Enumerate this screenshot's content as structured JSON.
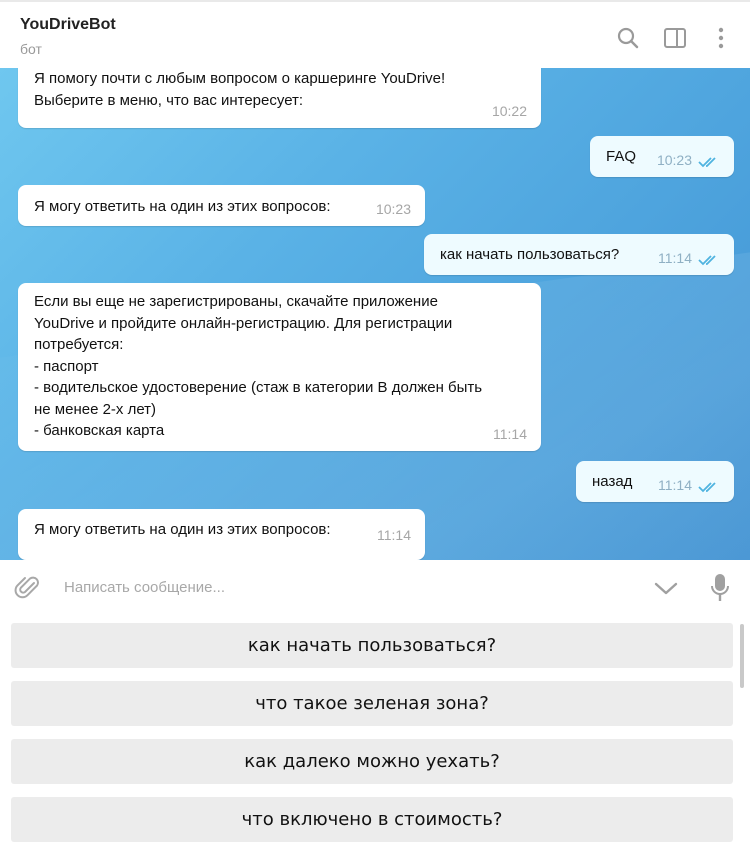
{
  "header": {
    "title": "YouDriveBot",
    "subtitle": "бот",
    "icons": [
      "search-icon",
      "sidebar-toggle-icon",
      "more-vertical-icon"
    ]
  },
  "messages": [
    {
      "direction": "in",
      "lines": [
        "Я помогу почти с любым вопросом о каршеринге YouDrive!",
        "Выберите в меню, что вас интересует:"
      ],
      "time": "10:22"
    },
    {
      "direction": "out",
      "text": "FAQ",
      "time": "10:23",
      "status": "read"
    },
    {
      "direction": "in",
      "text": "Я могу ответить на один из этих вопросов:",
      "time": "10:23"
    },
    {
      "direction": "out",
      "text": "как начать пользоваться?",
      "time": "11:14",
      "status": "read"
    },
    {
      "direction": "in",
      "lines": [
        "Если вы еще не зарегистрированы, скачайте приложение",
        "YouDrive и пройдите онлайн-регистрацию. Для регистрации",
        "потребуется:",
        "- паспорт",
        "- водительское удостоверение (стаж в категории B должен быть",
        "не менее 2-х лет)",
        "- банковская карта"
      ],
      "time": "11:14"
    },
    {
      "direction": "out",
      "text": "назад",
      "time": "11:14",
      "status": "read"
    },
    {
      "direction": "in",
      "text": "Я могу ответить на один из этих вопросов:",
      "time": "11:14"
    }
  ],
  "composer": {
    "placeholder": "Написать сообщение..."
  },
  "keyboard": [
    {
      "label": "как начать пользоваться?"
    },
    {
      "label": "что такое зеленая зона?"
    },
    {
      "label": "как далеко можно уехать?"
    },
    {
      "label": "что включено в стоимость?"
    }
  ],
  "colors": {
    "chat_bg": "#5ab2e6",
    "incoming_bubble": "#ffffff",
    "outgoing_bubble": "#eefbff",
    "read_check": "#4fb3e0",
    "keyboard_button": "#ececec"
  }
}
